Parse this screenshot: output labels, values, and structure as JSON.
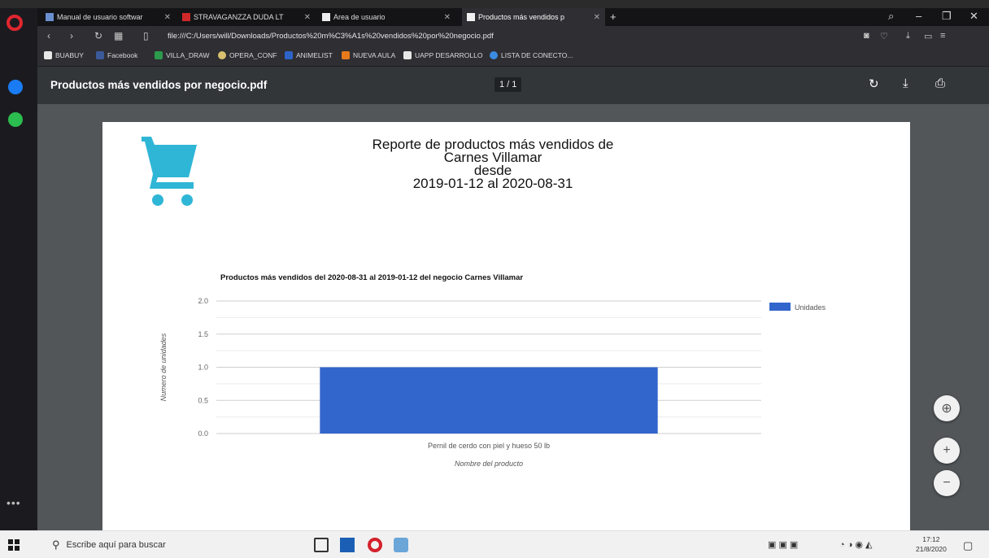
{
  "tabs": [
    {
      "label": "Manual de usuario softwar",
      "close": "✕"
    },
    {
      "label": "STRAVAGANZZA DUDA LT",
      "close": "✕"
    },
    {
      "label": "Area de usuario",
      "close": "✕"
    },
    {
      "label": "Productos más vendidos p",
      "close": "✕"
    }
  ],
  "tab_add": "+",
  "address": {
    "url": "file:///C:/Users/will/Downloads/Productos%20m%C3%A1s%20vendidos%20por%20negocio.pdf"
  },
  "bookmarks": [
    "BUABUY",
    "Facebook",
    "VILLA_DRAW",
    "OPERA_CONF",
    "ANIMELIST",
    "NUEVA AULA",
    "UAPP DESARROLLO",
    "LISTA DE CONECTO..."
  ],
  "pdf": {
    "filename": "Productos más vendidos por negocio.pdf",
    "page_indicator": "1 / 1",
    "report_title_lines": [
      "Reporte de productos más vendidos de",
      "Carnes Villamar",
      "desde",
      "2019-01-12 al 2020-08-31"
    ]
  },
  "chart_data": {
    "type": "bar",
    "title": "Productos más vendidos del  2020-08-31 al 2019-01-12 del negocio Carnes Villamar",
    "categories": [
      "Pernil de cerdo con piel y hueso 50 lb"
    ],
    "series": [
      {
        "name": "Unidades",
        "values": [
          1.0
        ]
      }
    ],
    "xlabel": "Nombre del producto",
    "ylabel": "Numero de unidades",
    "ylim": [
      0,
      2.0
    ],
    "yticks": [
      "0.0",
      "0.5",
      "1.0",
      "1.5",
      "2.0"
    ],
    "legend": "right",
    "grid": true,
    "bar_color": "#3366cc"
  },
  "taskbar": {
    "search_placeholder": "Escribe aquí para buscar",
    "time": "17:12",
    "date": "21/8/2020"
  }
}
